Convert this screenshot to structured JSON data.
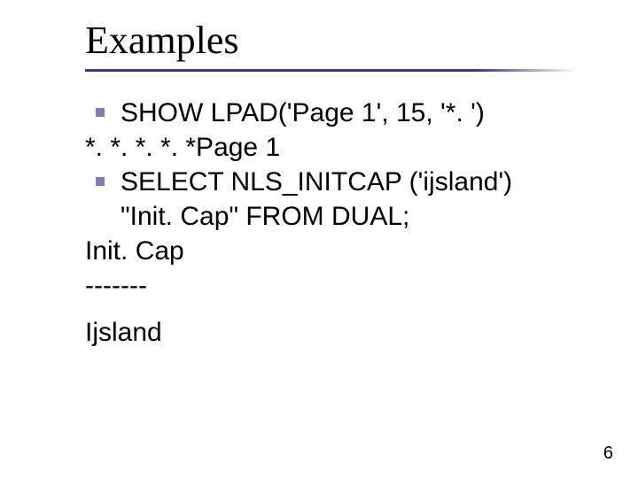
{
  "title": "Examples",
  "lines": {
    "l1": "SHOW LPAD('Page 1', 15, '*. ')",
    "l2": "*. *. *. *. *Page 1",
    "l3": "SELECT NLS_INITCAP ('ijsland')",
    "l4": "\"Init. Cap\" FROM DUAL;",
    "l5": "Init. Cap",
    "l6": "-------",
    "l7": "Ijsland"
  },
  "page_number": "6"
}
